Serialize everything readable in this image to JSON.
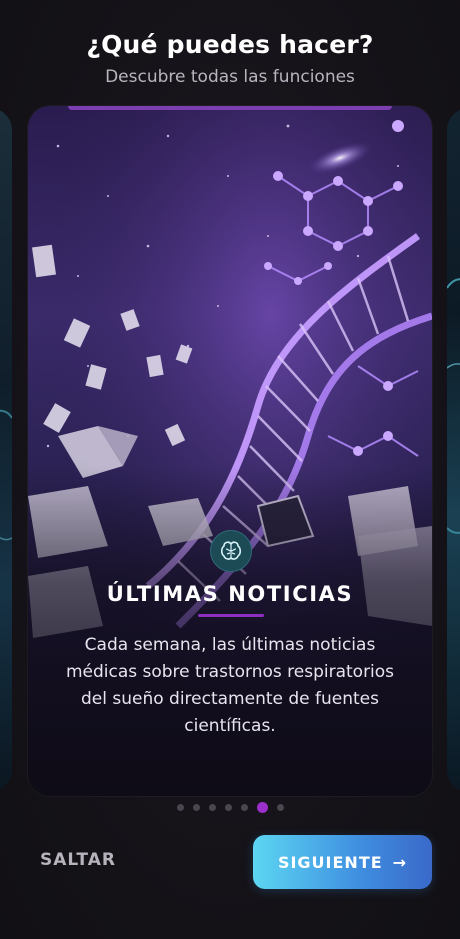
{
  "header": {
    "title": "¿Qué puedes hacer?",
    "subtitle": "Descubre todas las funciones"
  },
  "card": {
    "icon": "brain-icon",
    "title": "ÚLTIMAS NOTICIAS",
    "description": "Cada semana, las últimas noticias médicas sobre trastornos respiratorios del sueño directamente de fuentes científicas."
  },
  "pagination": {
    "total": 7,
    "active_index": 5
  },
  "footer": {
    "skip_label": "SALTAR",
    "next_label": "SIGUIENTE",
    "next_arrow": "→"
  },
  "colors": {
    "accent_purple": "#9b2fc9",
    "button_gradient_start": "#5cd6f2",
    "button_gradient_end": "#3a69c9",
    "background": "#151318"
  }
}
